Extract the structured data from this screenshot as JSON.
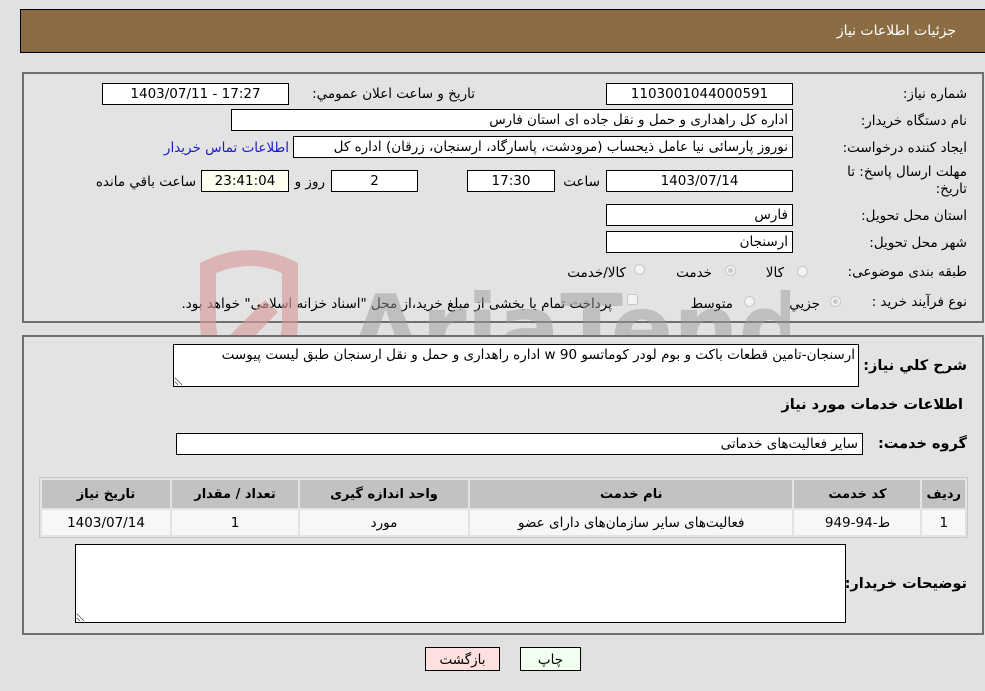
{
  "header": {
    "title": "جزئیات اطلاعات نیاز"
  },
  "info": {
    "need_number": {
      "label": "شماره نیاز:",
      "value": "1103001044000591"
    },
    "announce_datetime": {
      "label": "تاریخ و ساعت اعلان عمومي:",
      "value": "1403/07/11 - 17:27"
    },
    "buyer_org": {
      "label": "نام دستگاه خریدار:",
      "value": "اداره کل راهداری و حمل و نقل جاده ای استان فارس"
    },
    "requester": {
      "label": "ایجاد کننده درخواست:",
      "value": "نوروز پارسائی نیا عامل ذیحساب (مرودشت، پاسارگاد، ارسنجان، زرقان) اداره کل",
      "contact_link": "اطلاعات تماس خریدار"
    },
    "deadline": {
      "label": "مهلت ارسال پاسخ: تا تاریخ:",
      "date": "1403/07/14",
      "time_label": "ساعت",
      "time": "17:30",
      "days": "2",
      "days_label": "روز و",
      "remaining": "23:41:04",
      "remaining_label": "ساعت باقي مانده"
    },
    "delivery_province": {
      "label": "استان محل تحویل:",
      "value": "فارس"
    },
    "delivery_city": {
      "label": "شهر محل تحویل:",
      "value": "ارسنجان"
    },
    "category": {
      "label": "طبقه بندی موضوعی:",
      "options": [
        {
          "label": "کالا",
          "selected": false
        },
        {
          "label": "خدمت",
          "selected": true
        },
        {
          "label": "کالا/خدمت",
          "selected": false
        }
      ]
    },
    "purchase_type": {
      "label": "نوع فرآیند خرید :",
      "options": [
        {
          "label": "جزيي",
          "selected": true
        },
        {
          "label": "متوسط",
          "selected": false
        }
      ],
      "treasury_checkbox_label": "پرداخت تمام یا بخشی از مبلغ خرید،از محل \"اسناد خزانه اسلامی\" خواهد بود.",
      "treasury_checked": false
    }
  },
  "description": {
    "label": "شرح کلي نیاز:",
    "value": "ارسنجان-تامین قطعات باکت و بوم لودر کوماتسو w 90 اداره راهداری و حمل و نقل ارسنجان طبق لیست پیوست"
  },
  "services_section": {
    "title": "اطلاعات خدمات مورد نیاز",
    "group_label": "گروه خدمت:",
    "group_value": "سایر فعالیت‌های خدماتی"
  },
  "table": {
    "headers": [
      "ردیف",
      "کد خدمت",
      "نام خدمت",
      "واحد اندازه گیری",
      "تعداد / مقدار",
      "تاریخ نیاز"
    ],
    "rows": [
      [
        "1",
        "ط-94-949",
        "فعالیت‌های سایر سازمان‌های دارای عضو",
        "مورد",
        "1",
        "1403/07/14"
      ]
    ]
  },
  "buyer_notes": {
    "label": "توضیحات خریدار:",
    "value": ""
  },
  "buttons": {
    "print": "چاپ",
    "back": "بازگشت"
  },
  "watermark": {
    "text": "AriaTender.neT"
  },
  "colors": {
    "header_bg": "#8c6d43",
    "print_bg": "#f0fff0",
    "back_bg": "#ffe0e0",
    "link": "#1a1acc"
  }
}
